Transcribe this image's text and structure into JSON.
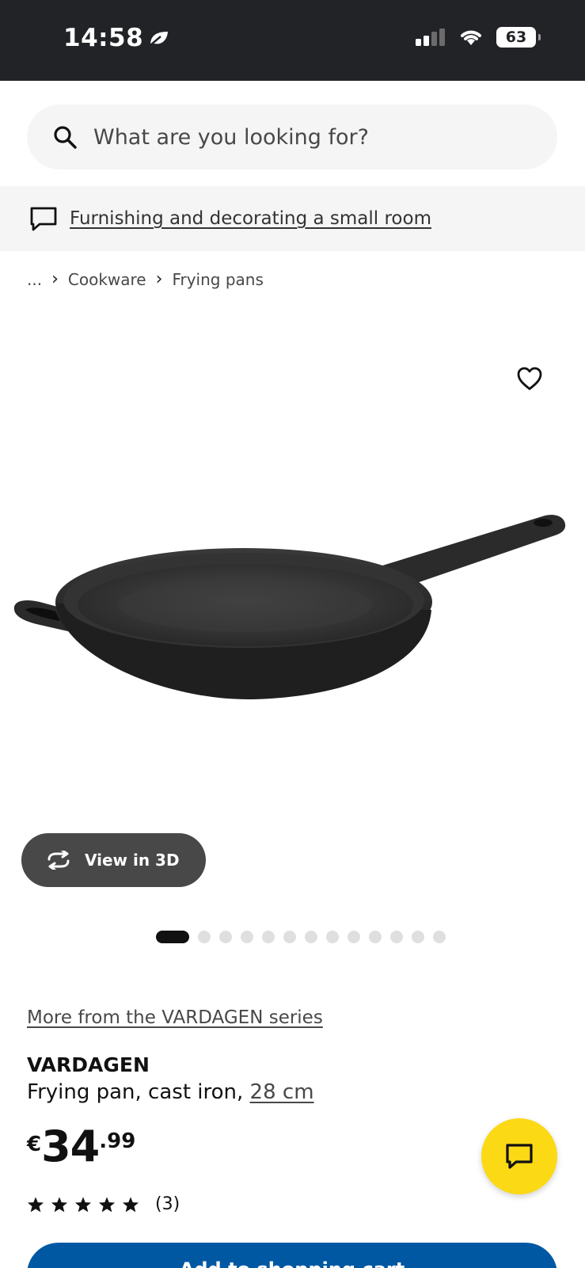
{
  "status_bar": {
    "time": "14:58",
    "battery": "63"
  },
  "search": {
    "placeholder": "What are you looking for?"
  },
  "promo": {
    "link_text": "Furnishing and decorating a small room"
  },
  "breadcrumb": {
    "ellipsis": "...",
    "items": [
      "Cookware",
      "Frying pans"
    ]
  },
  "gallery": {
    "view3d_label": "View in 3D",
    "image_count": 13,
    "active_index": 0
  },
  "product": {
    "series_link": "More from the VARDAGEN series",
    "name": "VARDAGEN",
    "description": "Frying pan, cast iron, ",
    "size": "28 cm",
    "price": {
      "currency": "€",
      "integer": "34",
      "decimals": ".99"
    },
    "rating": {
      "stars": 5,
      "count": "(3)"
    }
  },
  "actions": {
    "add_to_cart": "Add to shopping cart"
  },
  "colors": {
    "accent_blue": "#0058a3",
    "chat_yellow": "#fbd914",
    "status_bar": "#222327"
  }
}
